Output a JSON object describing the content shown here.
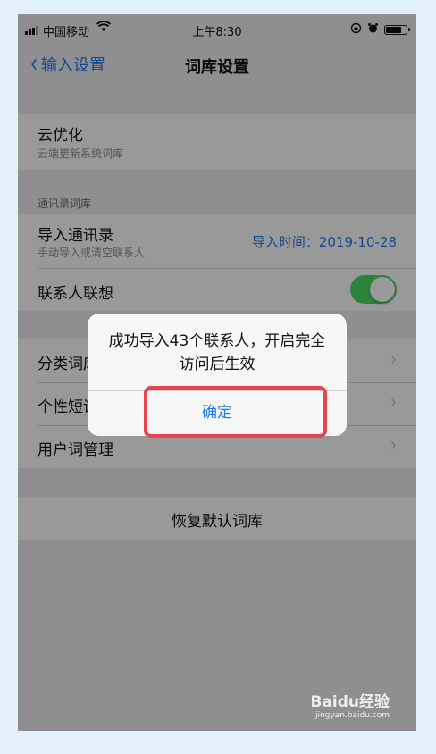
{
  "status_bar": {
    "carrier": "中国移动",
    "time": "上午8:30",
    "wifi_icon": "wifi-icon",
    "lock_icon": "rotation-lock-icon",
    "alarm_icon": "alarm-icon",
    "battery_level": 0.85
  },
  "nav": {
    "back_label": "输入设置",
    "title": "词库设置"
  },
  "cloud": {
    "title": "云优化",
    "subtitle": "云端更新系统词库"
  },
  "contacts_section": {
    "header": "通讯录词库",
    "import_title": "导入通讯录",
    "import_subtitle": "手动导入或清空联系人",
    "import_time": "导入时间：2019-10-28",
    "association_label": "联系人联想",
    "association_on": true
  },
  "lexicon_rows": [
    {
      "label": "分类词库"
    },
    {
      "label": "个性短语"
    },
    {
      "label": "用户词管理"
    }
  ],
  "restore_label": "恢复默认词库",
  "alert": {
    "message": "成功导入43个联系人，开启完全访问后生效",
    "confirm_label": "确定"
  },
  "watermark": {
    "text": "Baidu经验",
    "sub": "jingyan.baidu.com"
  },
  "colors": {
    "accent": "#1d7cf2",
    "toggle_on": "#4cd964",
    "highlight": "#e8434a"
  }
}
